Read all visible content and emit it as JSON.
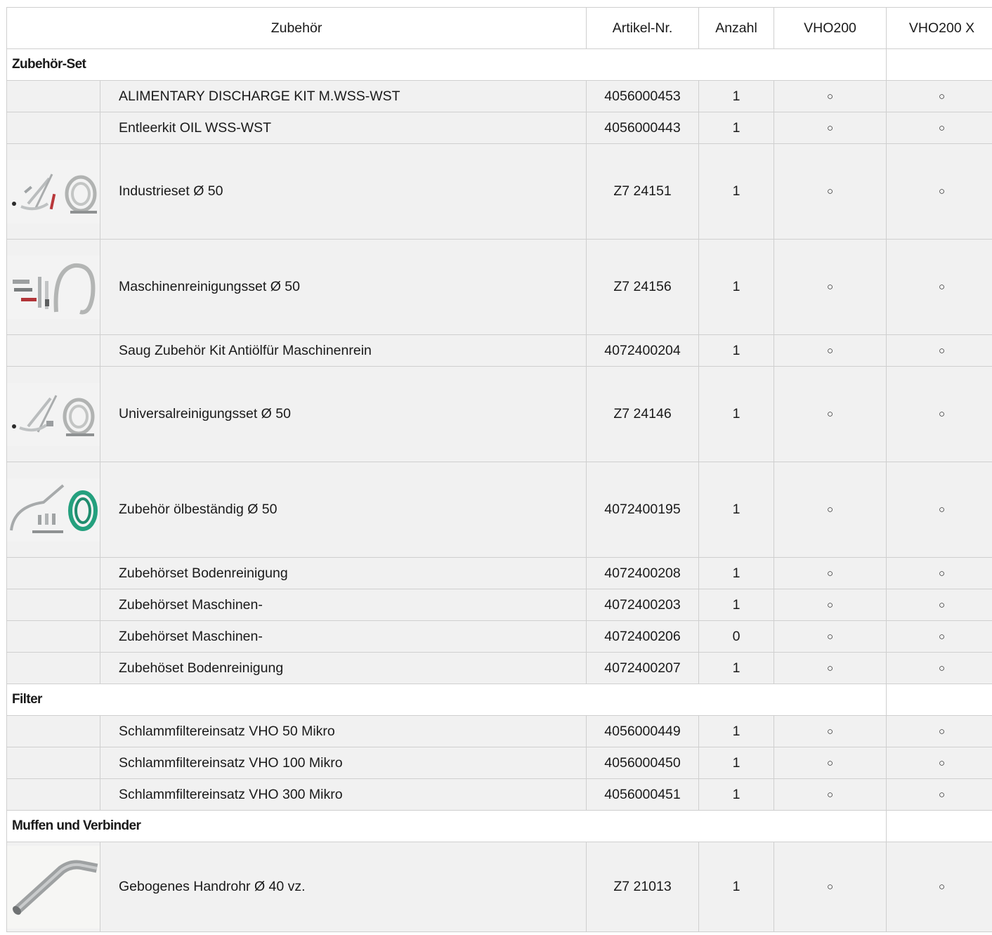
{
  "headers": {
    "accessory": "Zubehör",
    "article_no": "Artikel-Nr.",
    "quantity": "Anzahl",
    "model_a": "VHO200",
    "model_b": "VHO200 X"
  },
  "availability_symbol": "○",
  "sections": [
    {
      "title": "Zubehör-Set",
      "items": [
        {
          "name": "ALIMENTARY DISCHARGE KIT M.WSS-WST",
          "article": "4056000453",
          "qty": "1"
        },
        {
          "name": "Entleerkit OIL WSS-WST",
          "article": "4056000443",
          "qty": "1"
        },
        {
          "name": "Industrieset Ø 50",
          "article": "Z7 24151",
          "qty": "1",
          "image": "industrial-set-thumbnail"
        },
        {
          "name": "Maschinenreinigungsset Ø 50",
          "article": "Z7 24156",
          "qty": "1",
          "image": "machine-cleaning-set-thumbnail"
        },
        {
          "name": "Saug Zubehör Kit Antiölfür Maschinenrein",
          "article": "4072400204",
          "qty": "1"
        },
        {
          "name": "Universalreinigungsset Ø 50",
          "article": "Z7 24146",
          "qty": "1",
          "image": "universal-cleaning-set-thumbnail"
        },
        {
          "name": "Zubehör ölbeständig Ø 50",
          "article": "4072400195",
          "qty": "1",
          "image": "oil-resistant-set-thumbnail"
        },
        {
          "name": "Zubehörset Bodenreinigung",
          "article": "4072400208",
          "qty": "1"
        },
        {
          "name": "Zubehörset Maschinen-",
          "article": "4072400203",
          "qty": "1"
        },
        {
          "name": "Zubehörset Maschinen-",
          "article": "4072400206",
          "qty": "0"
        },
        {
          "name": "Zubehöset Bodenreinigung",
          "article": "4072400207",
          "qty": "1"
        }
      ]
    },
    {
      "title": "Filter",
      "items": [
        {
          "name": "Schlammfiltereinsatz VHO 50 Mikro",
          "article": "4056000449",
          "qty": "1"
        },
        {
          "name": "Schlammfiltereinsatz VHO 100 Mikro",
          "article": "4056000450",
          "qty": "1"
        },
        {
          "name": "Schlammfiltereinsatz VHO 300 Mikro",
          "article": "4056000451",
          "qty": "1"
        }
      ]
    },
    {
      "title": "Muffen und Verbinder",
      "items": [
        {
          "name": "Gebogenes Handrohr Ø 40 vz.",
          "article": "Z7 21013",
          "qty": "1",
          "image": "bent-hand-tube-thumbnail"
        }
      ]
    }
  ]
}
